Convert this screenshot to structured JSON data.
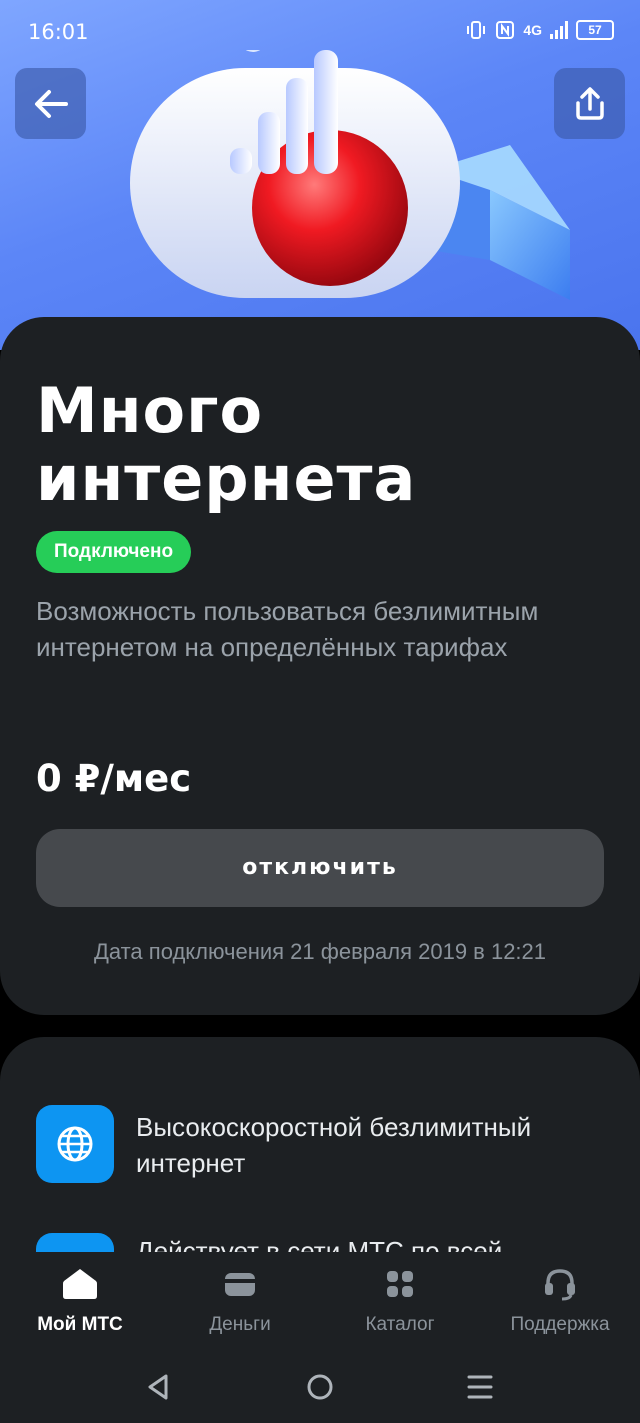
{
  "status_bar": {
    "time": "16:01",
    "network": "4G",
    "battery": "57"
  },
  "hero": {
    "back_icon": "arrow-left-icon",
    "share_icon": "share-icon"
  },
  "service": {
    "title": "Много интернета",
    "status": "Подключено",
    "description": "Возможность пользоваться безлимитным интернетом на определённых тарифах",
    "price": "0 ₽/мес",
    "disable_label": "отключить",
    "connection_date": "Дата подключения 21 февраля 2019 в 12:21"
  },
  "features": [
    {
      "icon": "globe-icon",
      "text": "Высокоскоростной безлимитный интернет"
    },
    {
      "icon": "map-icon",
      "text": "Действует в сети МТС по всей"
    }
  ],
  "colors": {
    "accent_green": "#26cd58",
    "accent_blue": "#0d95f2",
    "card_bg": "#1d2023"
  },
  "bottom_nav": [
    {
      "label": "Мой МТС",
      "icon": "home-icon",
      "active": true
    },
    {
      "label": "Деньги",
      "icon": "wallet-icon",
      "active": false
    },
    {
      "label": "Каталог",
      "icon": "grid-icon",
      "active": false
    },
    {
      "label": "Поддержка",
      "icon": "headset-icon",
      "active": false
    }
  ]
}
